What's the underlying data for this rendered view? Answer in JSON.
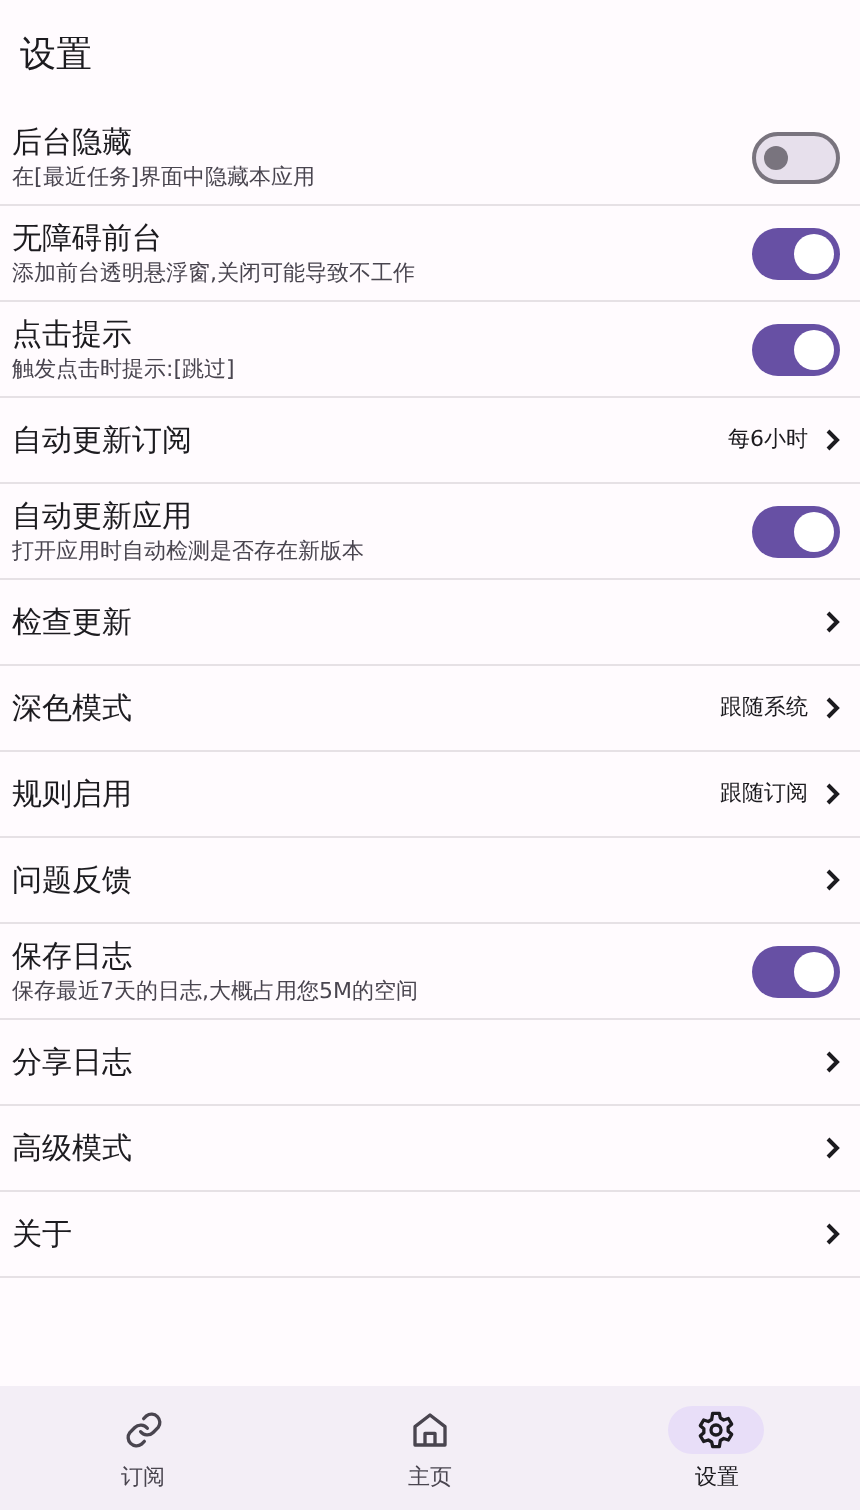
{
  "title": "设置",
  "rows": [
    {
      "kind": "switch",
      "label": "后台隐藏",
      "subtitle": "在[最近任务]界面中隐藏本应用",
      "on": false
    },
    {
      "kind": "switch",
      "label": "无障碍前台",
      "subtitle": "添加前台透明悬浮窗,关闭可能导致不工作",
      "on": true
    },
    {
      "kind": "switch",
      "label": "点击提示",
      "subtitle": "触发点击时提示:[跳过]",
      "on": true
    },
    {
      "kind": "link",
      "label": "自动更新订阅",
      "value": "每6小时"
    },
    {
      "kind": "switch",
      "label": "自动更新应用",
      "subtitle": "打开应用时自动检测是否存在新版本",
      "on": true
    },
    {
      "kind": "link",
      "label": "检查更新"
    },
    {
      "kind": "link",
      "label": "深色模式",
      "value": "跟随系统"
    },
    {
      "kind": "link",
      "label": "规则启用",
      "value": "跟随订阅"
    },
    {
      "kind": "link",
      "label": "问题反馈"
    },
    {
      "kind": "switch",
      "label": "保存日志",
      "subtitle": "保存最近7天的日志,大概占用您5M的空间",
      "on": true
    },
    {
      "kind": "link",
      "label": "分享日志"
    },
    {
      "kind": "link",
      "label": "高级模式"
    },
    {
      "kind": "link",
      "label": "关于"
    }
  ],
  "nav": [
    {
      "kind": "link",
      "label": "订阅",
      "selected": false
    },
    {
      "kind": "home",
      "label": "主页",
      "selected": false
    },
    {
      "kind": "gear",
      "label": "设置",
      "selected": true
    }
  ]
}
